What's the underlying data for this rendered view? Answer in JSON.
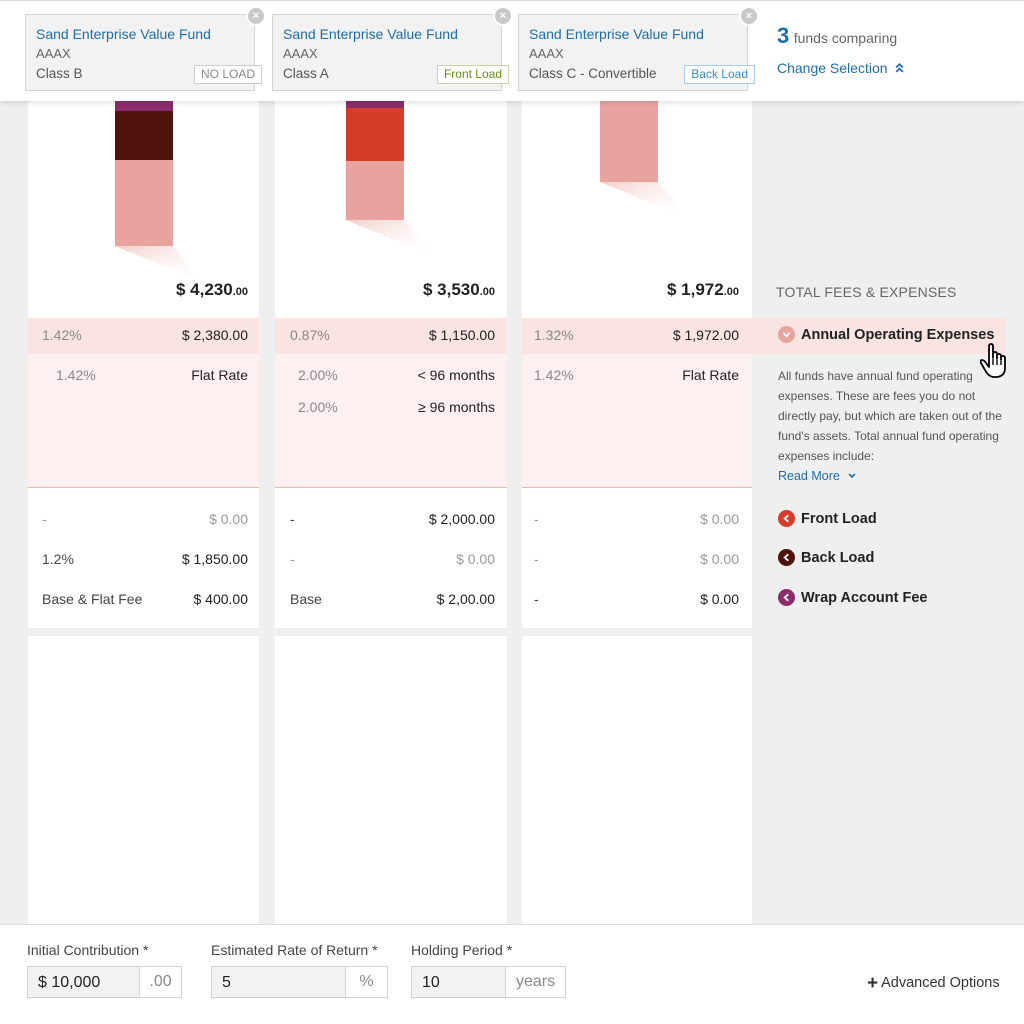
{
  "header": {
    "funds": [
      {
        "name": "Sand Enterprise Value Fund",
        "ticker": "AAAX",
        "class": "Class B",
        "load": "NO LOAD"
      },
      {
        "name": "Sand Enterprise Value Fund",
        "ticker": "AAAX",
        "class": "Class A",
        "load": "Front Load"
      },
      {
        "name": "Sand Enterprise Value Fund",
        "ticker": "AAAX",
        "class": "Class C - Convertible",
        "load": "Back Load"
      }
    ],
    "compare_count": "3",
    "compare_text": "funds comparing",
    "change_selection": "Change Selection",
    "close_glyph": "×"
  },
  "columns": [
    {
      "total_main": "$ 4,230",
      "total_cents": ".00",
      "aoe_pct": "1.42%",
      "aoe_amount": "$ 2,380.00",
      "detail_rows": [
        {
          "pct": "1.42%",
          "label": "Flat Rate"
        }
      ],
      "front_load": {
        "pct": "-",
        "amount": "$ 0.00"
      },
      "back_load": {
        "pct": "1.2%",
        "amount": "$ 1,850.00"
      },
      "wrap_fee": {
        "pct": "Base & Flat Fee",
        "amount": "$ 400.00"
      }
    },
    {
      "total_main": "$ 3,530",
      "total_cents": ".00",
      "aoe_pct": "0.87%",
      "aoe_amount": "$ 1,150.00",
      "detail_rows": [
        {
          "pct": "2.00%",
          "label": "< 96 months"
        },
        {
          "pct": "2.00%",
          "label": "≥ 96 months"
        }
      ],
      "front_load": {
        "pct": "-",
        "amount": "$ 2,000.00"
      },
      "back_load": {
        "pct": "-",
        "amount": "$ 0.00"
      },
      "wrap_fee": {
        "pct": "Base",
        "amount": "$ 2,00.00"
      }
    },
    {
      "total_main": "$ 1,972",
      "total_cents": ".00",
      "aoe_pct": "1.32%",
      "aoe_amount": "$ 1,972.00",
      "detail_rows": [
        {
          "pct": "1.42%",
          "label": "Flat Rate"
        }
      ],
      "front_load": {
        "pct": "-",
        "amount": "$ 0.00"
      },
      "back_load": {
        "pct": "-",
        "amount": "$ 0.00"
      },
      "wrap_fee": {
        "pct": "-",
        "amount": "$ 0.00"
      }
    }
  ],
  "legend": {
    "section_title": "TOTAL FEES & EXPENSES",
    "annual_operating": "Annual Operating Expenses",
    "description": "All funds have annual fund operating expenses. These are fees you do not directly pay, but which are taken out of the fund's assets. Total annual fund operating expenses include:",
    "read_more": "Read More",
    "front_load": "Front Load",
    "back_load": "Back Load",
    "wrap_fee": "Wrap Account Fee",
    "colors": {
      "annual_operating": "#e8a39e",
      "front_load": "#d63c28",
      "back_load": "#4e130b",
      "wrap_fee": "#8b2d6b"
    }
  },
  "inputs": {
    "initial_contribution": {
      "label": "Initial Contribution *",
      "value": "$ 10,000",
      "suffix": ".00"
    },
    "rate_of_return": {
      "label": "Estimated Rate of Return *",
      "value": "5",
      "suffix": "%"
    },
    "holding_period": {
      "label": "Holding Period *",
      "value": "10",
      "suffix": "years"
    },
    "advanced_options": "Advanced Options"
  }
}
